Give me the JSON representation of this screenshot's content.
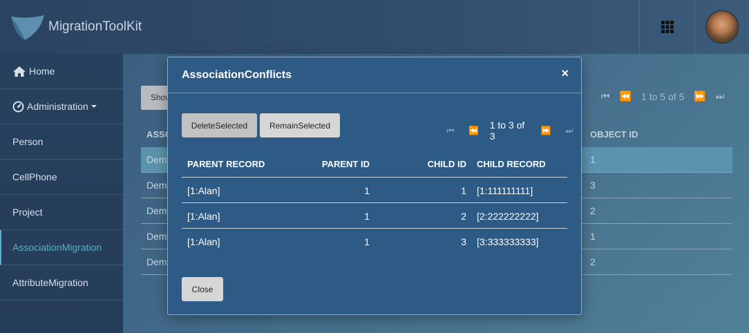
{
  "app": {
    "title": "MigrationToolKit"
  },
  "header": {
    "grid_icon": "apps-grid-icon",
    "avatar": "user-avatar"
  },
  "sidebar": {
    "items": [
      {
        "label": "Home",
        "icon": "home-icon"
      },
      {
        "label": "Administration",
        "icon": "dashboard-icon"
      },
      {
        "label": "Person"
      },
      {
        "label": "CellPhone"
      },
      {
        "label": "Project"
      },
      {
        "label": "AssociationMigration",
        "active": true
      },
      {
        "label": "AttributeMigration"
      }
    ]
  },
  "background": {
    "show_button": "Show",
    "pager": "1 to 5 of 5",
    "header_col1": "ASSO",
    "header_objid": "OBJECT ID",
    "rows": [
      {
        "c1": "Dem",
        "objid": "1"
      },
      {
        "c1": "Dem",
        "objid": "3"
      },
      {
        "c1": "Dem",
        "objid": "2"
      },
      {
        "c1": "Dem",
        "objid": "1"
      },
      {
        "c1": "Dem",
        "objid": "2"
      }
    ]
  },
  "modal": {
    "title": "AssociationConflicts",
    "close_x": "×",
    "delete_button": "DeleteSelected",
    "remain_button": "RemainSelected",
    "pager": "1 to 3 of 3",
    "columns": [
      "PARENT RECORD",
      "PARENT ID",
      "CHILD ID",
      "CHILD RECORD"
    ],
    "rows": [
      {
        "parent_record": "[1:Alan]",
        "parent_id": "1",
        "child_id": "1",
        "child_record": "[1:111111111]"
      },
      {
        "parent_record": "[1:Alan]",
        "parent_id": "1",
        "child_id": "2",
        "child_record": "[2:222222222]"
      },
      {
        "parent_record": "[1:Alan]",
        "parent_id": "1",
        "child_id": "3",
        "child_record": "[3:333333333]"
      }
    ],
    "close_button": "Close"
  },
  "colors": {
    "accent": "#5ab0c8",
    "modal_bg": "#2e5a86",
    "selected_row": "#5a93ab"
  }
}
